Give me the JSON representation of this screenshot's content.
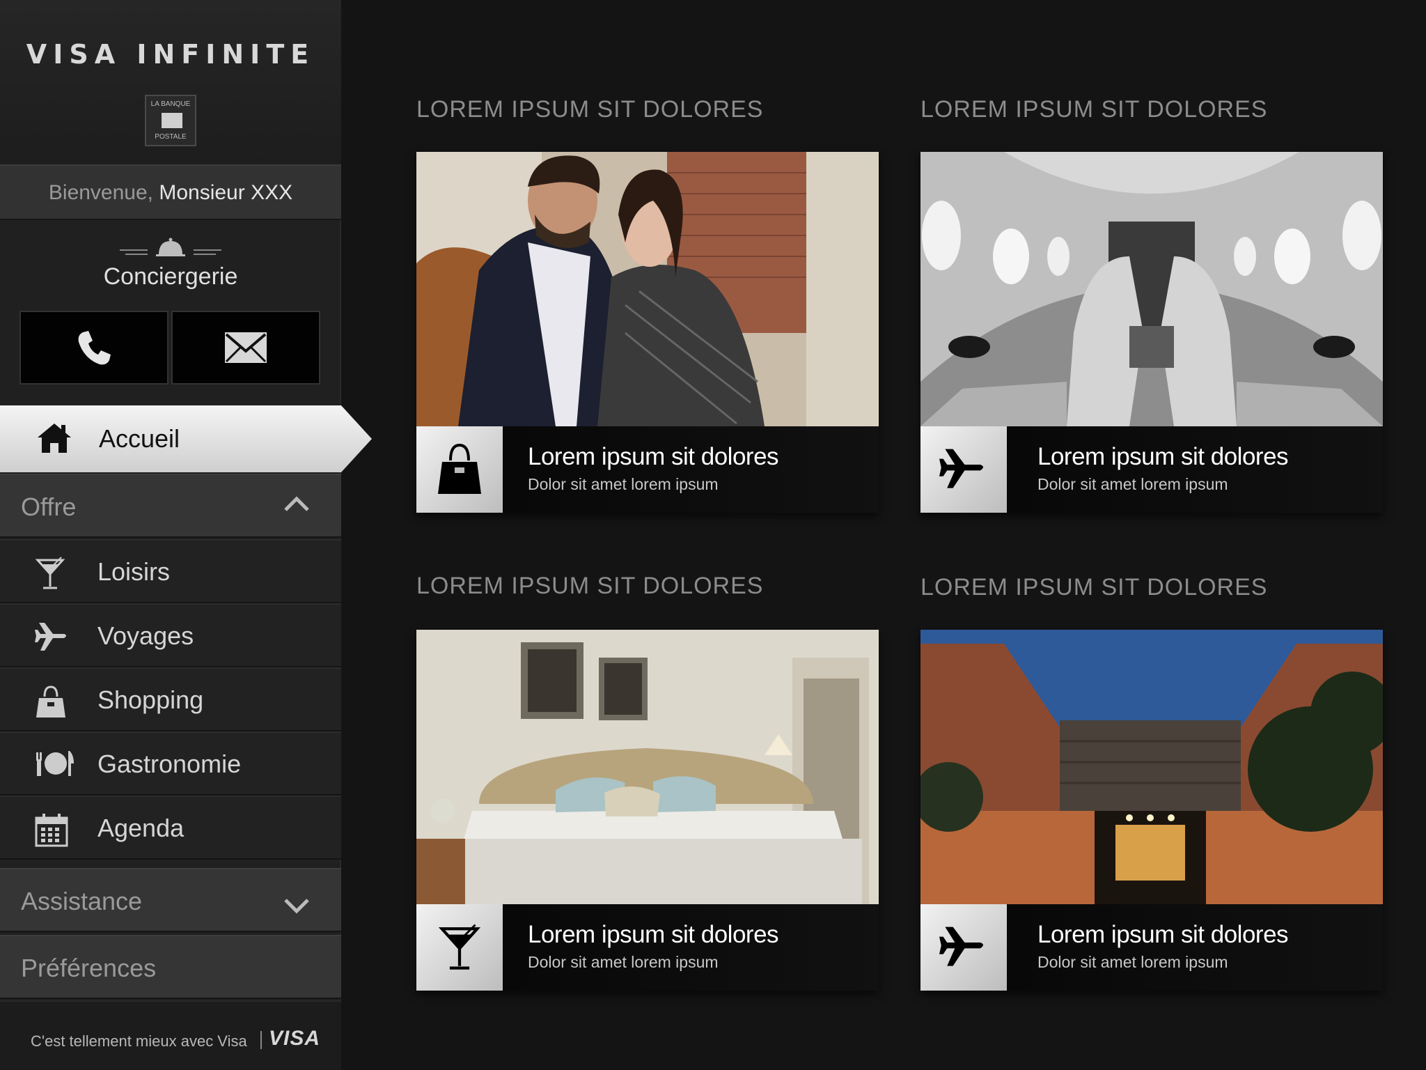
{
  "brand": {
    "name": "VISA INFINITE",
    "bank_line1": "LA BANQUE",
    "bank_line2": "POSTALE"
  },
  "welcome": {
    "greeting": "Bienvenue, ",
    "user": "Monsieur XXX"
  },
  "concierge": {
    "title": "Conciergerie",
    "phone_icon": "phone-icon",
    "mail_icon": "envelope-icon"
  },
  "nav": {
    "active": {
      "label": "Accueil",
      "icon": "home-icon"
    },
    "offre": {
      "label": "Offre",
      "state": "expanded"
    },
    "items": [
      {
        "label": "Loisirs",
        "icon": "cocktail-icon"
      },
      {
        "label": "Voyages",
        "icon": "plane-icon"
      },
      {
        "label": "Shopping",
        "icon": "handbag-icon"
      },
      {
        "label": "Gastronomie",
        "icon": "dining-icon"
      },
      {
        "label": "Agenda",
        "icon": "calendar-icon"
      }
    ],
    "assistance": {
      "label": "Assistance",
      "state": "collapsed"
    },
    "preferences": {
      "label": "Préférences"
    }
  },
  "footer": {
    "tagline": "C'est tellement mieux avec Visa",
    "logo": "VISA"
  },
  "cards": [
    {
      "section_title": "LOREM IPSUM SIT DOLORES",
      "title": "Lorem ipsum sit dolores",
      "subtitle": "Dolor sit amet lorem ipsum",
      "icon": "handbag-icon"
    },
    {
      "section_title": "LOREM IPSUM SIT DOLORES",
      "title": "Lorem ipsum sit dolores",
      "subtitle": "Dolor sit amet lorem ipsum",
      "icon": "plane-icon"
    },
    {
      "section_title": "LOREM IPSUM SIT DOLORES",
      "title": "Lorem ipsum sit dolores",
      "subtitle": "Dolor sit amet lorem ipsum",
      "icon": "cocktail-icon"
    },
    {
      "section_title": "LOREM IPSUM SIT DOLORES",
      "title": "Lorem ipsum sit dolores",
      "subtitle": "Dolor sit amet lorem ipsum",
      "icon": "plane-icon"
    }
  ],
  "colors": {
    "background": "#141414",
    "sidebar": "#202020",
    "active_tab": "#e8e8e8",
    "section_title": "#8c8c8c"
  }
}
